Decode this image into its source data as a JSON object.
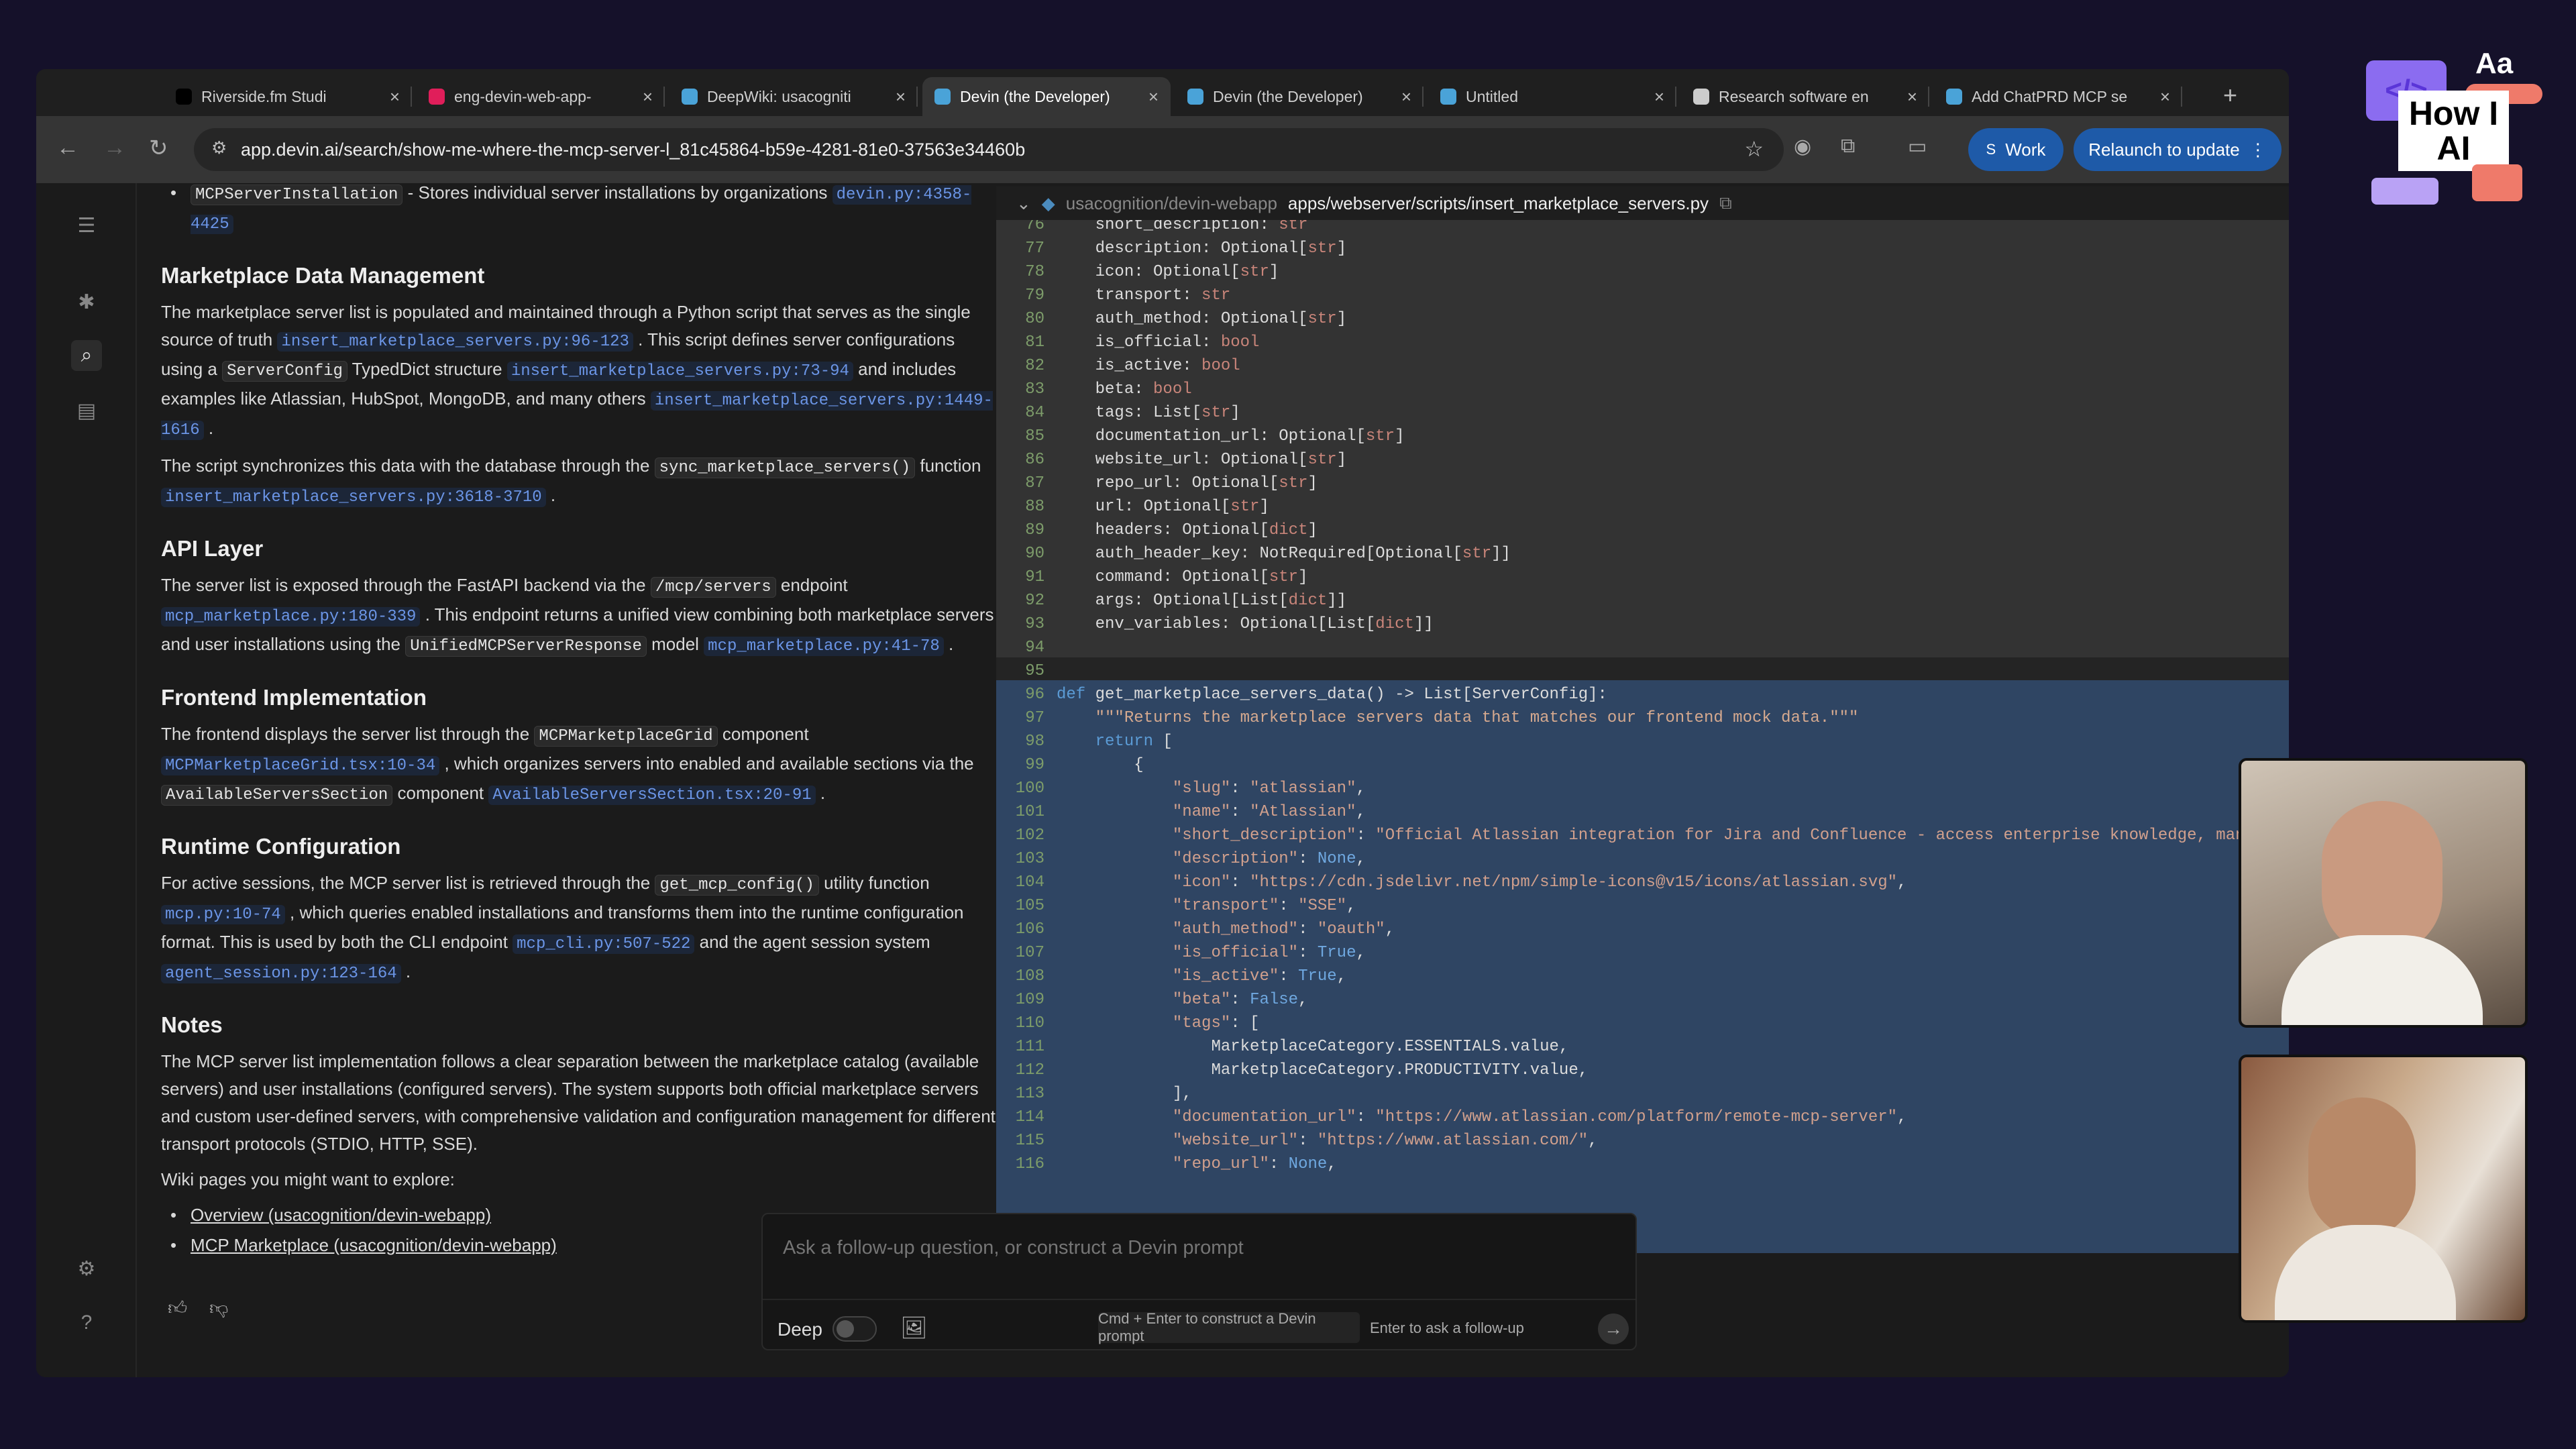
{
  "browser": {
    "tabs": [
      {
        "label": "Riverside.fm Studi",
        "icon_color": "#000000",
        "active": false
      },
      {
        "label": "eng-devin-web-app-",
        "icon_color": "#e01e5a",
        "active": false
      },
      {
        "label": "DeepWiki: usacogniti",
        "icon_color": "#4aa3d8",
        "active": false
      },
      {
        "label": "Devin (the Developer)",
        "icon_color": "#4aa3d8",
        "active": true
      },
      {
        "label": "Devin (the Developer)",
        "icon_color": "#4aa3d8",
        "active": false
      },
      {
        "label": "Untitled",
        "icon_color": "#4aa3d8",
        "active": false
      },
      {
        "label": "Research software en",
        "icon_color": "#cccccc",
        "active": false
      },
      {
        "label": "Add ChatPRD MCP se",
        "icon_color": "#4aa3d8",
        "active": false
      }
    ],
    "close_glyph": "×",
    "new_tab_glyph": "+",
    "url": "app.devin.ai/search/show-me-where-the-mcp-server-l_81c45864-b59e-4281-81e0-37563e34460b",
    "profile_initial": "S",
    "profile_label": "Work",
    "relaunch_label": "Relaunch to update"
  },
  "doc": {
    "blocks": [
      {
        "type": "li",
        "segs": [
          {
            "k": "code",
            "t": "MCPServerInstallation"
          },
          {
            "k": "txt",
            "t": " - Stores individual server installations by organizations "
          },
          {
            "k": "lnk",
            "t": "devin.py:4358-4425"
          }
        ]
      },
      {
        "type": "h2",
        "segs": [
          {
            "k": "txt",
            "t": "Marketplace Data Management"
          }
        ]
      },
      {
        "type": "p",
        "segs": [
          {
            "k": "txt",
            "t": "The marketplace server list is populated and maintained through a Python script that serves as the single source of truth "
          },
          {
            "k": "lnk",
            "t": "insert_marketplace_servers.py:96-123"
          },
          {
            "k": "txt",
            "t": " . This script defines server configurations using a "
          },
          {
            "k": "code",
            "t": "ServerConfig"
          },
          {
            "k": "txt",
            "t": " TypedDict structure "
          },
          {
            "k": "lnk",
            "t": "insert_marketplace_servers.py:73-94"
          },
          {
            "k": "txt",
            "t": " and includes examples like Atlassian, HubSpot, MongoDB, and many others "
          },
          {
            "k": "lnk",
            "t": "insert_marketplace_servers.py:1449-1616"
          },
          {
            "k": "txt",
            "t": " ."
          }
        ]
      },
      {
        "type": "p",
        "segs": [
          {
            "k": "txt",
            "t": "The script synchronizes this data with the database through the "
          },
          {
            "k": "code",
            "t": "sync_marketplace_servers()"
          },
          {
            "k": "txt",
            "t": " function "
          },
          {
            "k": "lnk",
            "t": "insert_marketplace_servers.py:3618-3710"
          },
          {
            "k": "txt",
            "t": " ."
          }
        ]
      },
      {
        "type": "h2",
        "segs": [
          {
            "k": "txt",
            "t": "API Layer"
          }
        ]
      },
      {
        "type": "p",
        "segs": [
          {
            "k": "txt",
            "t": "The server list is exposed through the FastAPI backend via the "
          },
          {
            "k": "code",
            "t": "/mcp/servers"
          },
          {
            "k": "txt",
            "t": " endpoint "
          },
          {
            "k": "lnk",
            "t": "mcp_marketplace.py:180-339"
          },
          {
            "k": "txt",
            "t": " . This endpoint returns a unified view combining both marketplace servers and user installations using the "
          },
          {
            "k": "code",
            "t": "UnifiedMCPServerResponse"
          },
          {
            "k": "txt",
            "t": " model "
          },
          {
            "k": "lnk",
            "t": "mcp_marketplace.py:41-78"
          },
          {
            "k": "txt",
            "t": " ."
          }
        ]
      },
      {
        "type": "h2",
        "segs": [
          {
            "k": "txt",
            "t": "Frontend Implementation"
          }
        ]
      },
      {
        "type": "p",
        "segs": [
          {
            "k": "txt",
            "t": "The frontend displays the server list through the "
          },
          {
            "k": "code",
            "t": "MCPMarketplaceGrid"
          },
          {
            "k": "txt",
            "t": " component "
          },
          {
            "k": "lnk",
            "t": "MCPMarketplaceGrid.tsx:10-34"
          },
          {
            "k": "txt",
            "t": " , which organizes servers into enabled and available sections via the "
          },
          {
            "k": "code",
            "t": "AvailableServersSection"
          },
          {
            "k": "txt",
            "t": " component "
          },
          {
            "k": "lnk",
            "t": "AvailableServersSection.tsx:20-91"
          },
          {
            "k": "txt",
            "t": " ."
          }
        ]
      },
      {
        "type": "h2",
        "segs": [
          {
            "k": "txt",
            "t": "Runtime Configuration"
          }
        ]
      },
      {
        "type": "p",
        "segs": [
          {
            "k": "txt",
            "t": "For active sessions, the MCP server list is retrieved through the "
          },
          {
            "k": "code",
            "t": "get_mcp_config()"
          },
          {
            "k": "txt",
            "t": " utility function "
          },
          {
            "k": "lnk",
            "t": "mcp.py:10-74"
          },
          {
            "k": "txt",
            "t": " , which queries enabled installations and transforms them into the runtime configuration format. This is used by both the CLI endpoint "
          },
          {
            "k": "lnk",
            "t": "mcp_cli.py:507-522"
          },
          {
            "k": "txt",
            "t": " and the agent session system "
          },
          {
            "k": "lnk",
            "t": "agent_session.py:123-164"
          },
          {
            "k": "txt",
            "t": " ."
          }
        ]
      },
      {
        "type": "h2",
        "segs": [
          {
            "k": "txt",
            "t": "Notes"
          }
        ]
      },
      {
        "type": "p",
        "segs": [
          {
            "k": "txt",
            "t": "The MCP server list implementation follows a clear separation between the marketplace catalog (available servers) and user installations (configured servers). The system supports both official marketplace servers and custom user-defined servers, with comprehensive validation and configuration management for different transport protocols (STDIO, HTTP, SSE)."
          }
        ]
      },
      {
        "type": "p",
        "segs": [
          {
            "k": "txt",
            "t": "Wiki pages you might want to explore:"
          }
        ]
      },
      {
        "type": "li",
        "segs": [
          {
            "k": "ul",
            "t": "Overview (usacognition/devin-webapp)"
          }
        ]
      },
      {
        "type": "li",
        "segs": [
          {
            "k": "ul",
            "t": "MCP Marketplace (usacognition/devin-webapp)"
          }
        ]
      }
    ]
  },
  "code_panel": {
    "repo": "usacognition/devin-webapp",
    "path": "apps/webserver/scripts/insert_marketplace_servers.py",
    "lines": [
      {
        "n": "76",
        "p": [
          [
            "",
            "    short_description: "
          ],
          [
            "t",
            "str"
          ]
        ]
      },
      {
        "n": "77",
        "p": [
          [
            "",
            "    description: Optional["
          ],
          [
            "t",
            "str"
          ],
          [
            "",
            "]"
          ]
        ]
      },
      {
        "n": "78",
        "p": [
          [
            "",
            "    icon: Optional["
          ],
          [
            "t",
            "str"
          ],
          [
            "",
            "]"
          ]
        ]
      },
      {
        "n": "79",
        "p": [
          [
            "",
            "    transport: "
          ],
          [
            "t",
            "str"
          ]
        ]
      },
      {
        "n": "80",
        "p": [
          [
            "",
            "    auth_method: Optional["
          ],
          [
            "t",
            "str"
          ],
          [
            "",
            "]"
          ]
        ]
      },
      {
        "n": "81",
        "p": [
          [
            "",
            "    is_official: "
          ],
          [
            "t",
            "bool"
          ]
        ]
      },
      {
        "n": "82",
        "p": [
          [
            "",
            "    is_active: "
          ],
          [
            "t",
            "bool"
          ]
        ]
      },
      {
        "n": "83",
        "p": [
          [
            "",
            "    beta: "
          ],
          [
            "t",
            "bool"
          ]
        ]
      },
      {
        "n": "84",
        "p": [
          [
            "",
            "    tags: List["
          ],
          [
            "t",
            "str"
          ],
          [
            "",
            "]"
          ]
        ]
      },
      {
        "n": "85",
        "p": [
          [
            "",
            "    documentation_url: Optional["
          ],
          [
            "t",
            "str"
          ],
          [
            "",
            "]"
          ]
        ]
      },
      {
        "n": "86",
        "p": [
          [
            "",
            "    website_url: Optional["
          ],
          [
            "t",
            "str"
          ],
          [
            "",
            "]"
          ]
        ]
      },
      {
        "n": "87",
        "p": [
          [
            "",
            "    repo_url: Optional["
          ],
          [
            "t",
            "str"
          ],
          [
            "",
            "]"
          ]
        ]
      },
      {
        "n": "88",
        "p": [
          [
            "",
            "    url: Optional["
          ],
          [
            "t",
            "str"
          ],
          [
            "",
            "]"
          ]
        ]
      },
      {
        "n": "89",
        "p": [
          [
            "",
            "    headers: Optional["
          ],
          [
            "t",
            "dict"
          ],
          [
            "",
            "]"
          ]
        ]
      },
      {
        "n": "90",
        "p": [
          [
            "",
            "    auth_header_key: NotRequired[Optional["
          ],
          [
            "t",
            "str"
          ],
          [
            "",
            "]]"
          ]
        ]
      },
      {
        "n": "91",
        "p": [
          [
            "",
            "    command: Optional["
          ],
          [
            "t",
            "str"
          ],
          [
            "",
            "]"
          ]
        ]
      },
      {
        "n": "92",
        "p": [
          [
            "",
            "    args: Optional[List["
          ],
          [
            "t",
            "dict"
          ],
          [
            "",
            "]]"
          ]
        ]
      },
      {
        "n": "93",
        "p": [
          [
            "",
            "    env_variables: Optional[List["
          ],
          [
            "t",
            "dict"
          ],
          [
            "",
            "]]"
          ]
        ]
      },
      {
        "n": "94",
        "p": []
      },
      {
        "n": "95",
        "p": []
      },
      {
        "n": "96",
        "p": [
          [
            "k",
            "def"
          ],
          [
            "",
            " get_marketplace_servers_data() -> List[ServerConfig]:"
          ]
        ]
      },
      {
        "n": "97",
        "p": [
          [
            "d",
            "    \"\"\"Returns the marketplace servers data that matches our frontend mock data.\"\"\""
          ]
        ]
      },
      {
        "n": "98",
        "p": [
          [
            "k",
            "    return"
          ],
          [
            "",
            " ["
          ]
        ]
      },
      {
        "n": "99",
        "p": [
          [
            "",
            "        {"
          ]
        ]
      },
      {
        "n": "100",
        "p": [
          [
            "s",
            "            \"slug\""
          ],
          [
            "",
            ": "
          ],
          [
            "s",
            "\"atlassian\""
          ],
          [
            "",
            ","
          ]
        ]
      },
      {
        "n": "101",
        "p": [
          [
            "s",
            "            \"name\""
          ],
          [
            "",
            ": "
          ],
          [
            "s",
            "\"Atlassian\""
          ],
          [
            "",
            ","
          ]
        ]
      },
      {
        "n": "102",
        "p": [
          [
            "s",
            "            \"short_description\""
          ],
          [
            "",
            ": "
          ],
          [
            "s",
            "\"Official Atlassian integration for Jira and Confluence - access enterprise knowledge, manag"
          ]
        ]
      },
      {
        "n": "103",
        "p": [
          [
            "s",
            "            \"description\""
          ],
          [
            "",
            ": "
          ],
          [
            "c",
            "None"
          ],
          [
            "",
            ","
          ]
        ]
      },
      {
        "n": "104",
        "p": [
          [
            "s",
            "            \"icon\""
          ],
          [
            "",
            ": "
          ],
          [
            "s",
            "\"https://cdn.jsdelivr.net/npm/simple-icons@v15/icons/atlassian.svg\""
          ],
          [
            "",
            ","
          ]
        ]
      },
      {
        "n": "105",
        "p": [
          [
            "s",
            "            \"transport\""
          ],
          [
            "",
            ": "
          ],
          [
            "s",
            "\"SSE\""
          ],
          [
            "",
            ","
          ]
        ]
      },
      {
        "n": "106",
        "p": [
          [
            "s",
            "            \"auth_method\""
          ],
          [
            "",
            ": "
          ],
          [
            "s",
            "\"oauth\""
          ],
          [
            "",
            ","
          ]
        ]
      },
      {
        "n": "107",
        "p": [
          [
            "s",
            "            \"is_official\""
          ],
          [
            "",
            ": "
          ],
          [
            "c",
            "True"
          ],
          [
            "",
            ","
          ]
        ]
      },
      {
        "n": "108",
        "p": [
          [
            "s",
            "            \"is_active\""
          ],
          [
            "",
            ": "
          ],
          [
            "c",
            "True"
          ],
          [
            "",
            ","
          ]
        ]
      },
      {
        "n": "109",
        "p": [
          [
            "s",
            "            \"beta\""
          ],
          [
            "",
            ": "
          ],
          [
            "c",
            "False"
          ],
          [
            "",
            ","
          ]
        ]
      },
      {
        "n": "110",
        "p": [
          [
            "s",
            "            \"tags\""
          ],
          [
            "",
            ": ["
          ]
        ]
      },
      {
        "n": "111",
        "p": [
          [
            "",
            "                MarketplaceCategory.ESSENTIALS.value,"
          ]
        ]
      },
      {
        "n": "112",
        "p": [
          [
            "",
            "                MarketplaceCategory.PRODUCTIVITY.value,"
          ]
        ]
      },
      {
        "n": "113",
        "p": [
          [
            "",
            "            ],"
          ]
        ]
      },
      {
        "n": "114",
        "p": [
          [
            "s",
            "            \"documentation_url\""
          ],
          [
            "",
            ": "
          ],
          [
            "s",
            "\"https://www.atlassian.com/platform/remote-mcp-server\""
          ],
          [
            "",
            ","
          ]
        ]
      },
      {
        "n": "115",
        "p": [
          [
            "s",
            "            \"website_url\""
          ],
          [
            "",
            ": "
          ],
          [
            "s",
            "\"https://www.atlassian.com/\""
          ],
          [
            "",
            ","
          ]
        ]
      },
      {
        "n": "116",
        "p": [
          [
            "s",
            "            \"repo_url\""
          ],
          [
            "",
            ": "
          ],
          [
            "c",
            "None"
          ],
          [
            "",
            ","
          ]
        ]
      }
    ]
  },
  "ask": {
    "placeholder": "Ask a follow-up question, or construct a Devin prompt",
    "deep_label": "Deep",
    "deep_enabled": false,
    "cmd_hint": "Cmd + Enter to construct a Devin prompt",
    "enter_hint": "Enter to ask a follow-up"
  },
  "overlay": {
    "logo_text": "How I AI",
    "logo_aa": "Aa"
  }
}
